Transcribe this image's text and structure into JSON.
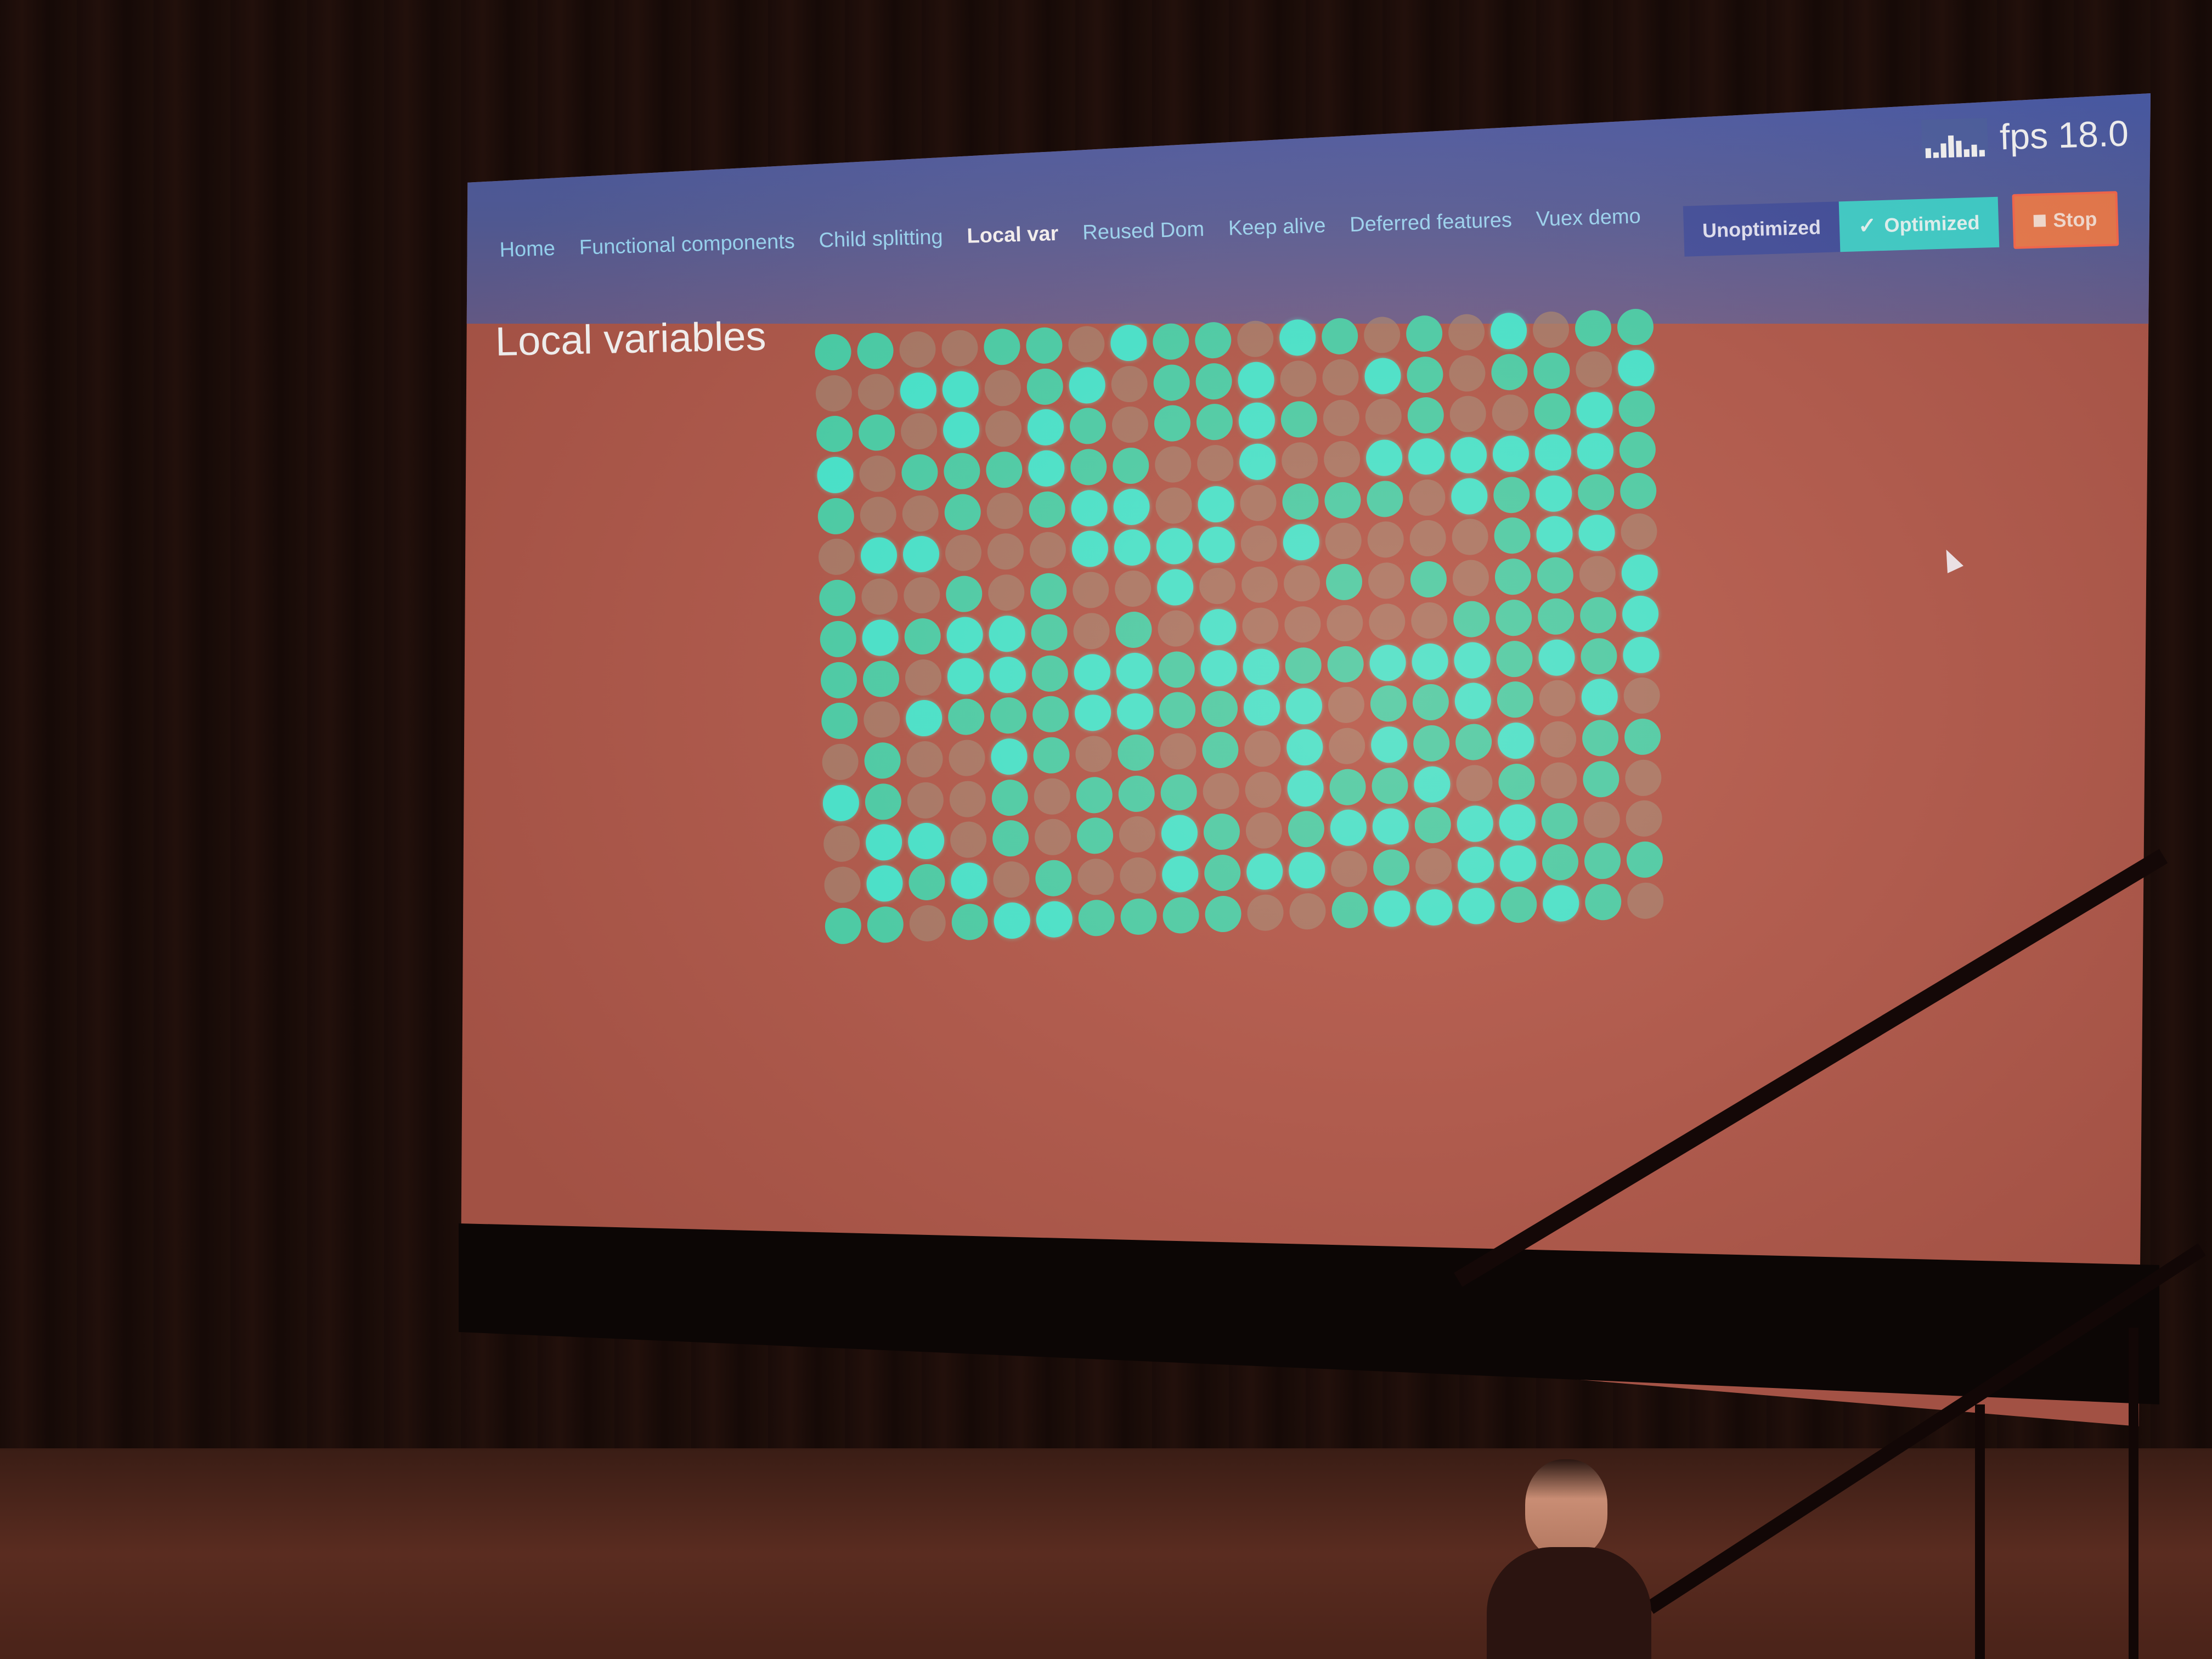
{
  "nav": {
    "items": [
      {
        "label": "Home"
      },
      {
        "label": "Functional components"
      },
      {
        "label": "Child splitting"
      },
      {
        "label": "Local var",
        "active": true
      },
      {
        "label": "Reused Dom"
      },
      {
        "label": "Keep alive"
      },
      {
        "label": "Deferred features"
      },
      {
        "label": "Vuex demo"
      }
    ]
  },
  "page": {
    "title": "Local variables"
  },
  "fps": {
    "label": "fps 18.0"
  },
  "controls": {
    "unoptimized_label": "Unoptimized",
    "optimized_label": "Optimized",
    "stop_label": "Stop"
  },
  "colors": {
    "header": "#4d5fae",
    "accent_teal": "#3dd6d1",
    "stop_orange": "#f07e4f",
    "dot_bright": "#3ff0d6",
    "dot_dim": "#a58571",
    "page_background": "#b0584a"
  },
  "icons": {
    "fps_graph": "fps-graph-icon",
    "check": "check-icon",
    "stop": "stop-icon",
    "cursor": "mouse-cursor-icon"
  }
}
